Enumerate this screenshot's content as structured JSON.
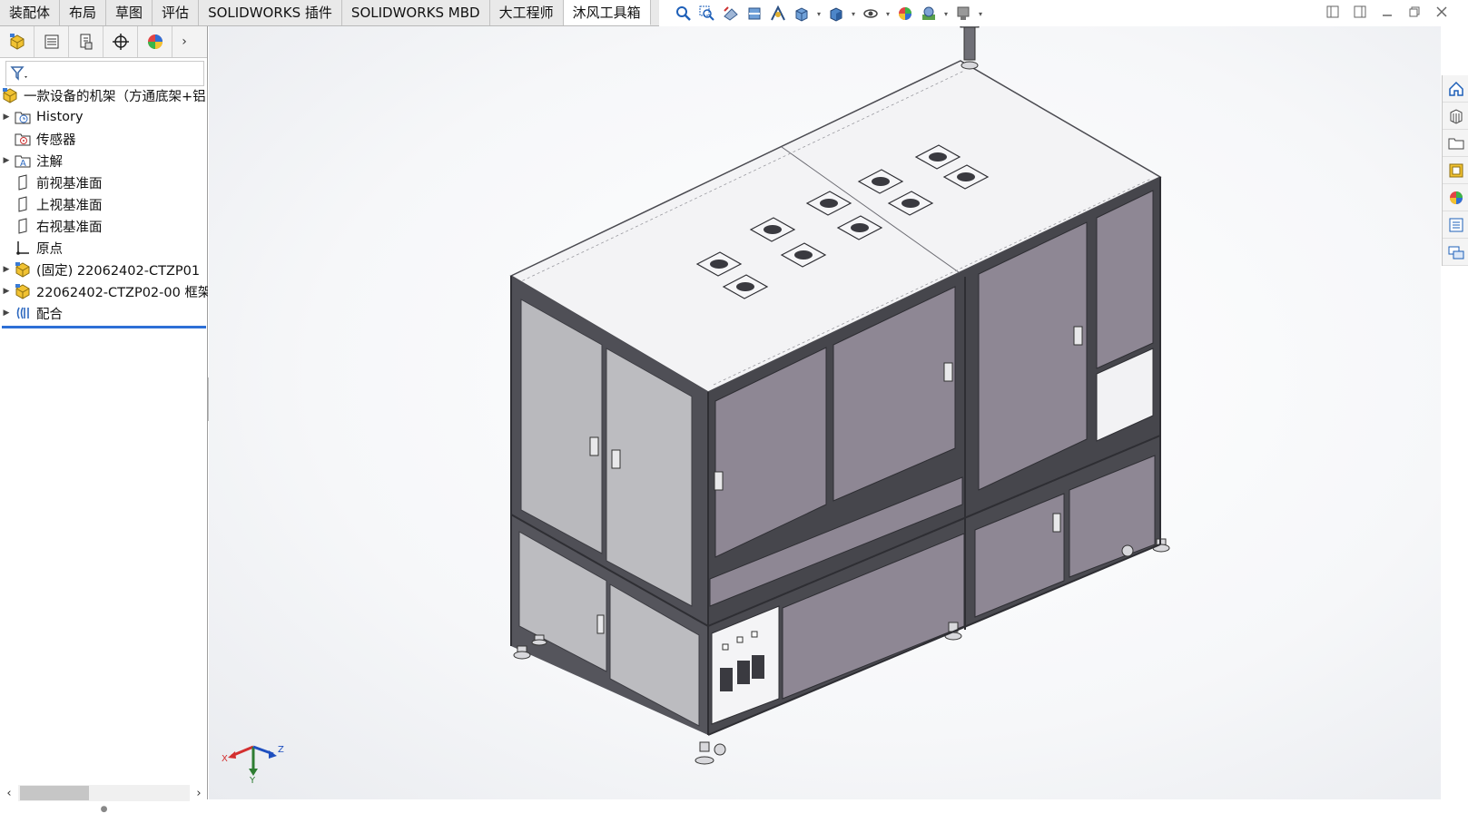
{
  "tabs": [
    "装配体",
    "布局",
    "草图",
    "评估",
    "SOLIDWORKS 插件",
    "SOLIDWORKS MBD",
    "大工程师",
    "沐风工具箱"
  ],
  "active_tab": "沐风工具箱",
  "tree": {
    "root": "一款设备的机架（方通底架+铝",
    "items": [
      {
        "label": "History",
        "expand": true,
        "icon": "history-folder-icon"
      },
      {
        "label": "传感器",
        "expand": false,
        "icon": "sensor-icon"
      },
      {
        "label": "注解",
        "expand": true,
        "icon": "annotation-icon"
      },
      {
        "label": "前视基准面",
        "expand": false,
        "icon": "plane-icon"
      },
      {
        "label": "上视基准面",
        "expand": false,
        "icon": "plane-icon"
      },
      {
        "label": "右视基准面",
        "expand": false,
        "icon": "plane-icon"
      },
      {
        "label": "原点",
        "expand": false,
        "icon": "origin-icon"
      },
      {
        "label": "(固定) 22062402-CTZP01",
        "expand": true,
        "icon": "part-icon"
      },
      {
        "label": "22062402-CTZP02-00 框架",
        "expand": true,
        "icon": "part-icon"
      },
      {
        "label": "配合",
        "expand": true,
        "icon": "mates-icon"
      }
    ]
  },
  "triad": {
    "x": "X",
    "y": "Y",
    "z": "Z"
  },
  "colors": {
    "panel_fill": "#8e8794",
    "frame": "#55555c",
    "top": "#f4f4f6"
  }
}
